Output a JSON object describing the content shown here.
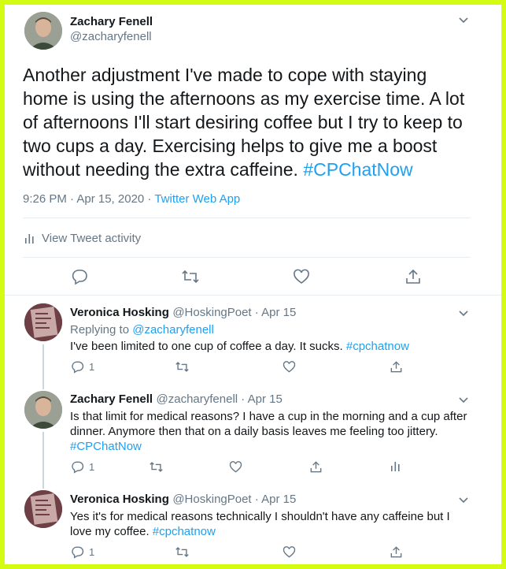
{
  "main_tweet": {
    "author_name": "Zachary Fenell",
    "author_handle": "@zacharyfenell",
    "text_before_tag": "Another adjustment I've made to cope with staying home is using the afternoons as my exercise time. A lot of afternoons I'll start desiring coffee but I try to keep to two cups a day. Exercising helps to give me a boost without needing the extra caffeine.",
    "hashtag": "#CPChatNow",
    "timestamp": "9:26 PM · Apr 15, 2020 · ",
    "source": "Twitter Web App",
    "activity_label": "View Tweet activity"
  },
  "replies": [
    {
      "author_name": "Veronica Hosking",
      "author_handle": "@HoskingPoet",
      "date": " · Apr 15",
      "replying_prefix": "Replying to ",
      "replying_handle": "@zacharyfenell",
      "text": "I've been limited to one cup of coffee a day. It sucks. ",
      "hashtag": "#cpchatnow",
      "reply_count": "1"
    },
    {
      "author_name": "Zachary Fenell",
      "author_handle": "@zacharyfenell",
      "date": " · Apr 15",
      "text_line1": "Is that limit for medical reasons? I have a cup in the morning and a cup after",
      "text_line2": "dinner. Anymore then that on a daily basis leaves me feeling too jittery.",
      "hashtag": "#CPChatNow",
      "reply_count": "1"
    },
    {
      "author_name": "Veronica Hosking",
      "author_handle": "@HoskingPoet",
      "date": " · Apr 15",
      "text_line1": "Yes it's for medical reasons technically I shouldn't have any caffeine but I",
      "text_line2": "love my coffee. ",
      "hashtag": "#cpchatnow",
      "reply_count": "1"
    }
  ],
  "colors": {
    "border": "#d4fb12",
    "link": "#1da1f2",
    "muted": "#657786"
  },
  "icons": [
    "reply-icon",
    "retweet-icon",
    "like-icon",
    "share-icon",
    "analytics-icon",
    "chevron-down-icon"
  ]
}
